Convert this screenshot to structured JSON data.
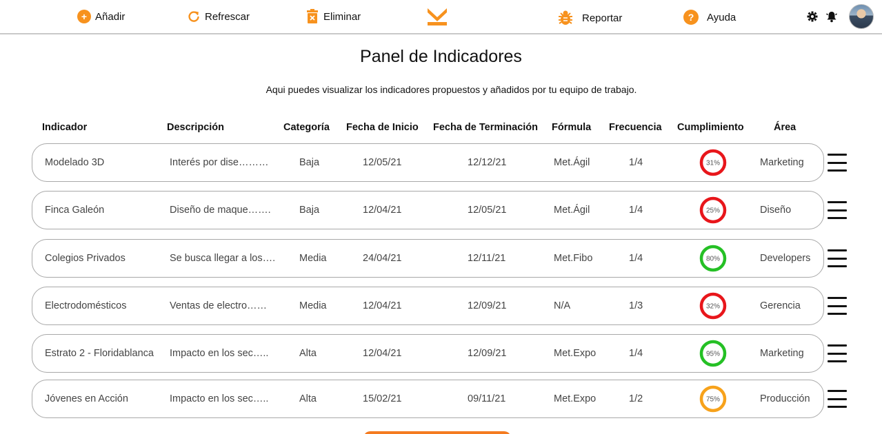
{
  "toolbar": {
    "add_label": "Añadir",
    "refresh_label": "Refrescar",
    "delete_label": "Eliminar",
    "report_label": "Reportar",
    "help_label": "Ayuda",
    "add_glyph": "+",
    "help_glyph": "?"
  },
  "page": {
    "title": "Panel de Indicadores",
    "subtitle": "Aqui puedes visualizar los indicadores propuestos y añadidos por tu equipo de trabajo."
  },
  "table": {
    "headers": {
      "indicator": "Indicador",
      "description": "Descripción",
      "category": "Categoría",
      "start_date": "Fecha de Inicio",
      "end_date": "Fecha de Terminación",
      "formula": "Fórmula",
      "frequency": "Frecuencia",
      "compliance": "Cumplimiento",
      "area": "Área"
    },
    "rows": [
      {
        "indicator": "Modelado 3D",
        "description": "Interés por dise………",
        "category": "Baja",
        "start_date": "12/05/21",
        "end_date": "12/12/21",
        "formula": "Met.Ágil",
        "frequency": "1/4",
        "compliance": "31%",
        "compliance_value": 31,
        "area": "Marketing",
        "status_color": "#e8161b"
      },
      {
        "indicator": "Finca Galeón",
        "description": "Diseño de maque…….",
        "category": "Baja",
        "start_date": "12/04/21",
        "end_date": "12/05/21",
        "formula": "Met.Ágil",
        "frequency": "1/4",
        "compliance": "25%",
        "compliance_value": 25,
        "area": "Diseño",
        "status_color": "#e8161b"
      },
      {
        "indicator": "Colegios Privados",
        "description": "Se busca llegar a los….",
        "category": "Media",
        "start_date": "24/04/21",
        "end_date": "12/11/21",
        "formula": "Met.Fibo",
        "frequency": "1/4",
        "compliance": "80%",
        "compliance_value": 80,
        "area": "Developers",
        "status_color": "#25c025"
      },
      {
        "indicator": "Electrodomésticos",
        "description": "Ventas de electro……",
        "category": "Media",
        "start_date": "12/04/21",
        "end_date": "12/09/21",
        "formula": "N/A",
        "frequency": "1/3",
        "compliance": "32%",
        "compliance_value": 32,
        "area": "Gerencia",
        "status_color": "#e8161b"
      },
      {
        "indicator": "Estrato 2 - Floridablanca",
        "description": "Impacto en los sec…..",
        "category": "Alta",
        "start_date": "12/04/21",
        "end_date": "12/09/21",
        "formula": "Met.Expo",
        "frequency": "1/4",
        "compliance": "95%",
        "compliance_value": 95,
        "area": "Marketing",
        "status_color": "#25c025"
      },
      {
        "indicator": "Jóvenes en Acción",
        "description": "Impacto en los sec…..",
        "category": "Alta",
        "start_date": "15/02/21",
        "end_date": "09/11/21",
        "formula": "Met.Expo",
        "frequency": "1/2",
        "compliance": "75%",
        "compliance_value": 75,
        "area": "Producción",
        "status_color": "#f7a21b"
      }
    ]
  },
  "colors": {
    "accent": "#f7921e",
    "danger": "#e8161b",
    "success": "#25c025",
    "warning": "#f7a21b",
    "border": "#a8a8a8"
  },
  "icons": {
    "add": "plus-circle-icon",
    "refresh": "refresh-icon",
    "delete": "trash-icon",
    "logo": "brand-logo",
    "report": "bug-icon",
    "help": "question-circle-icon",
    "settings": "gear-icon",
    "notifications": "bell-icon",
    "row_menu": "hamburger-menu-icon"
  }
}
